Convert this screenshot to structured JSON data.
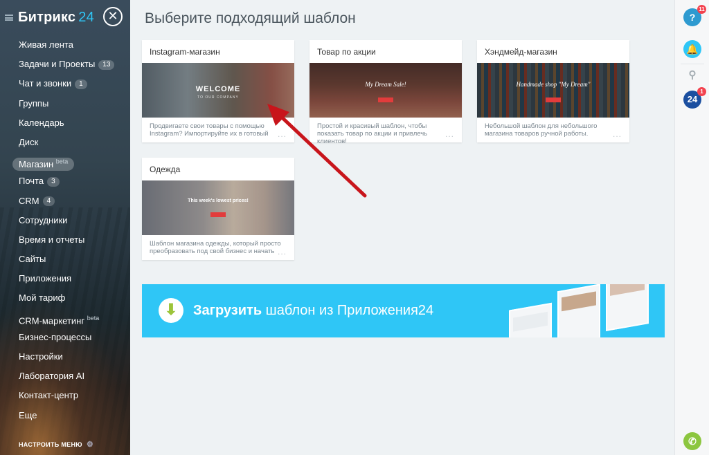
{
  "sidebar": {
    "logo": "Битрикс",
    "logo_num": "24",
    "items": [
      {
        "label": "Живая лента",
        "count": ""
      },
      {
        "label": "Задачи и Проекты",
        "count": "13"
      },
      {
        "label": "Чат и звонки",
        "count": "1"
      },
      {
        "label": "Группы",
        "count": ""
      },
      {
        "label": "Календарь",
        "count": ""
      },
      {
        "label": "Диск",
        "count": ""
      },
      {
        "label": "Магазин",
        "count": "",
        "sup": "beta"
      },
      {
        "label": "Почта",
        "count": "3"
      },
      {
        "label": "CRM",
        "count": "4"
      },
      {
        "label": "Сотрудники",
        "count": ""
      },
      {
        "label": "Время и отчеты",
        "count": ""
      },
      {
        "label": "Сайты",
        "count": ""
      },
      {
        "label": "Приложения",
        "count": ""
      },
      {
        "label": "Мой тариф",
        "count": ""
      },
      {
        "label": "CRM-маркетинг",
        "count": "",
        "sup": "beta"
      },
      {
        "label": "Бизнес-процессы",
        "count": ""
      },
      {
        "label": "Настройки",
        "count": ""
      },
      {
        "label": "Лаборатория AI",
        "count": ""
      },
      {
        "label": "Контакт-центр",
        "count": ""
      },
      {
        "label": "Еще",
        "count": ""
      }
    ],
    "setup_label": "НАСТРОИТЬ МЕНЮ"
  },
  "main": {
    "title": "Выберите подходящий шаблон",
    "cards": [
      {
        "title": "Instagram-магазин",
        "desc": "Продвигаете свои товары с помощью Instagram? Импортируйте их в готовый",
        "thumb_text": "WELCOME",
        "thumb_sub": "TO OUR COMPANY"
      },
      {
        "title": "Товар по акции",
        "desc": "Простой и красивый шаблон, чтобы показать товар по акции и привлечь клиентов!",
        "thumb_text": "My Dream Sale!"
      },
      {
        "title": "Хэндмейд-магазин",
        "desc": "Небольшой шаблон для небольшого магазина товаров ручной работы.",
        "thumb_text": "Handmade shop \"My Dream\""
      },
      {
        "title": "Одежда",
        "desc": "Шаблон магазина одежды, который просто преобразовать под свой бизнес и начать",
        "thumb_text": "This week's lowest prices!"
      }
    ],
    "more_label": "...",
    "banner": {
      "bold": "Загрузить",
      "rest": " шаблон из Приложения24"
    }
  },
  "rightbar": {
    "help_badge": "11",
    "b24_badge": "1",
    "b24_label": "24"
  },
  "colors": {
    "accent": "#2fc6f6",
    "badge": "#f3434f",
    "arrow": "#c8151b",
    "phone": "#8cc63f"
  }
}
